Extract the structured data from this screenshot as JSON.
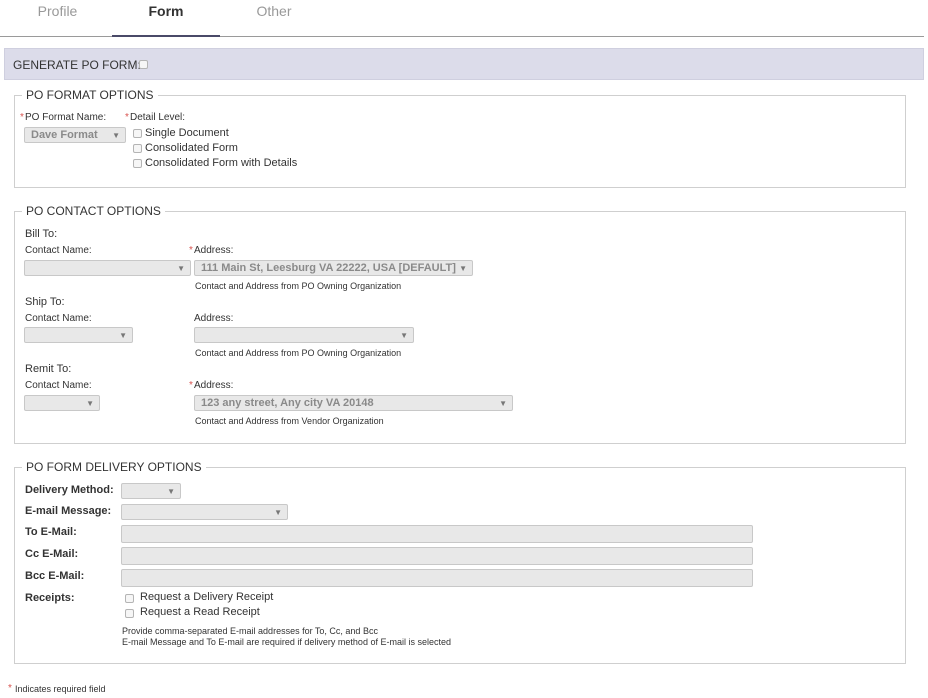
{
  "tabs": [
    {
      "label": "Profile"
    },
    {
      "label": "Form"
    },
    {
      "label": "Other"
    }
  ],
  "generate": {
    "label": "GENERATE PO FORM:"
  },
  "format_options": {
    "legend": "PO FORMAT OPTIONS",
    "format_name_label": "PO Format Name:",
    "format_name_value": "Dave Format",
    "detail_level_label": "Detail Level:",
    "detail_levels": [
      "Single Document",
      "Consolidated Form",
      "Consolidated Form with Details"
    ]
  },
  "contact_options": {
    "legend": "PO CONTACT OPTIONS",
    "contact_name_label": "Contact Name:",
    "address_label": "Address:",
    "bill_to": {
      "title": "Bill To:",
      "address_value": "111 Main St, Leesburg VA 22222, USA [DEFAULT]",
      "note": "Contact and Address from PO Owning Organization"
    },
    "ship_to": {
      "title": "Ship To:",
      "address_value": "",
      "note": "Contact and Address from PO Owning Organization"
    },
    "remit_to": {
      "title": "Remit To:",
      "address_value": "123 any street, Any city VA 20148",
      "note": "Contact and Address from Vendor Organization"
    }
  },
  "delivery_options": {
    "legend": "PO FORM DELIVERY OPTIONS",
    "method_label": "Delivery Method:",
    "message_label": "E-mail Message:",
    "to_label": "To E-Mail:",
    "cc_label": "Cc E-Mail:",
    "bcc_label": "Bcc E-Mail:",
    "receipts_label": "Receipts:",
    "receipts": [
      "Request a Delivery Receipt",
      "Request a Read Receipt"
    ],
    "note_1": "Provide comma-separated E-mail addresses for To, Cc, and Bcc",
    "note_2": "E-mail Message and To E-mail are required if delivery method of E-mail is selected"
  },
  "footer": {
    "required_note": "Indicates required field"
  },
  "icons": {
    "dropdown": "chevron-down-icon",
    "checkbox": "checkbox-icon",
    "asterisk": "required-asterisk-icon"
  },
  "colors": {
    "header_bar": "#dcdcea",
    "required": "#d9534f",
    "active_tab_underline": "#4a4a68"
  }
}
